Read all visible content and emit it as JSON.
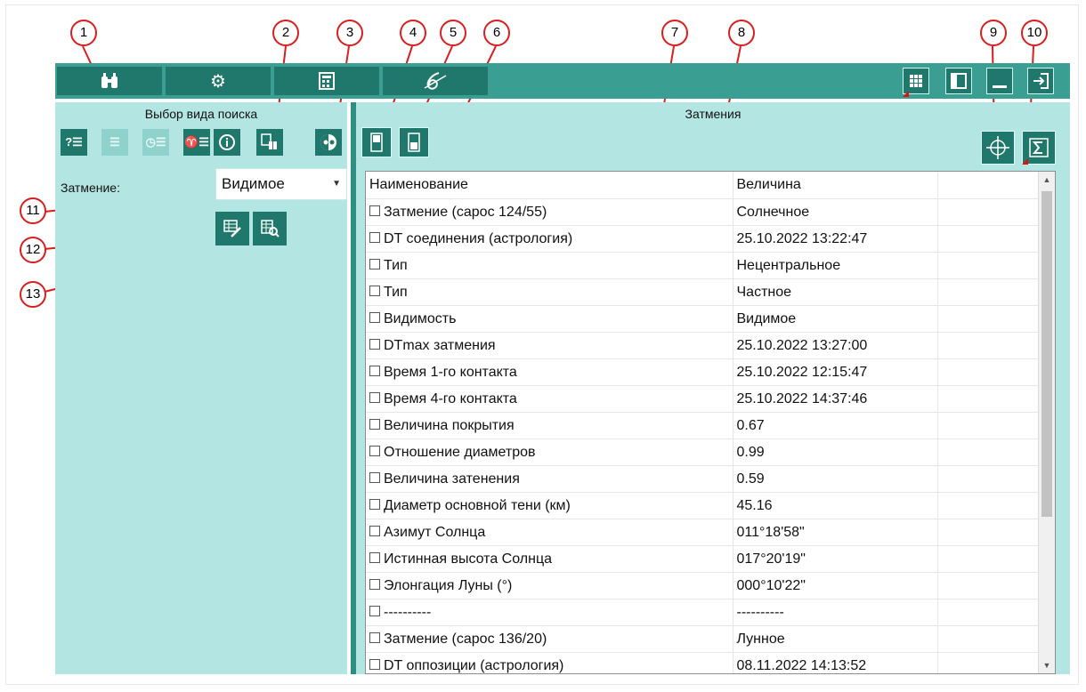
{
  "callouts": [
    "1",
    "2",
    "3",
    "4",
    "5",
    "6",
    "7",
    "8",
    "9",
    "10",
    "11",
    "12",
    "13"
  ],
  "toolbar": {
    "tabs": [
      {
        "icon": "binoculars-icon",
        "glyph": "🔭"
      },
      {
        "icon": "gear-icon",
        "glyph": "⚙"
      },
      {
        "icon": "calculator-icon",
        "glyph": "▦"
      },
      {
        "icon": "logo-icon",
        "glyph": "6"
      }
    ],
    "right_buttons": [
      {
        "icon": "grid-view-icon",
        "glyph": "☷"
      },
      {
        "icon": "panel-icon",
        "glyph": "▯"
      },
      {
        "icon": "minimize-icon",
        "glyph": "—"
      },
      {
        "icon": "exit-icon",
        "glyph": "⇥"
      }
    ]
  },
  "left_panel": {
    "title": "Выбор вида поиска",
    "eclipse_label": "Затмение:",
    "eclipse_value": "Видимое"
  },
  "right_panel": {
    "title": "Затмения"
  },
  "table": {
    "headers": [
      "Наименование",
      "Величина",
      ""
    ],
    "rows": [
      {
        "name": "Затмение (сарос 124/55)",
        "value": "Солнечное"
      },
      {
        "name": "DT соединения (астрология)",
        "value": "25.10.2022 13:22:47"
      },
      {
        "name": "Тип",
        "value": "Нецентральное"
      },
      {
        "name": "Тип",
        "value": "Частное"
      },
      {
        "name": "Видимость",
        "value": "Видимое"
      },
      {
        "name": "DTmax затмения",
        "value": "25.10.2022 13:27:00"
      },
      {
        "name": "Время 1-го контакта",
        "value": "25.10.2022 12:15:47"
      },
      {
        "name": "Время 4-го контакта",
        "value": "25.10.2022 14:37:46"
      },
      {
        "name": "Величина покрытия",
        "value": "0.67"
      },
      {
        "name": "Отношение диаметров",
        "value": "0.99"
      },
      {
        "name": "Величина затенения",
        "value": "0.59"
      },
      {
        "name": "Диаметр основной тени (км)",
        "value": "45.16"
      },
      {
        "name": "Азимут Солнца",
        "value": "011°18'58\""
      },
      {
        "name": "Истинная высота Солнца",
        "value": "017°20'19\""
      },
      {
        "name": "Элонгация Луны (°)",
        "value": "000°10'22\""
      },
      {
        "name": "----------",
        "value": "----------"
      },
      {
        "name": "Затмение (сарос 136/20)",
        "value": "Лунное"
      },
      {
        "name": "DT оппозиции (астрология)",
        "value": "08.11.2022 14:13:52"
      }
    ]
  },
  "colors": {
    "accent": "#1f786b",
    "toolbar": "#3a9f92",
    "panel": "#b3e6e3",
    "callout_border": "#d81e1e"
  }
}
